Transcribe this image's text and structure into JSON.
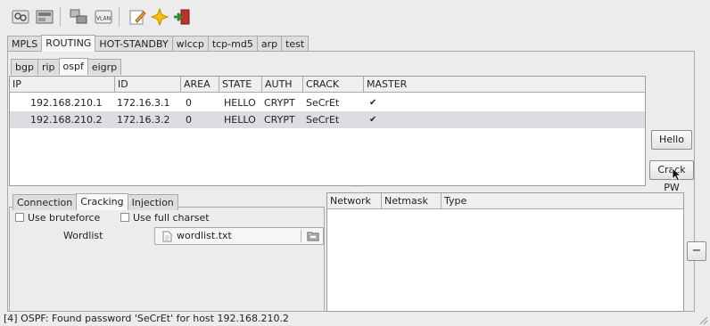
{
  "toolbar": {
    "buttons": [
      {
        "icon": "interfaces-icon"
      },
      {
        "icon": "card-icon"
      },
      {
        "icon": "network-icon"
      },
      {
        "icon": "vlan-icon",
        "text": "VLAN"
      },
      {
        "icon": "edit-icon"
      },
      {
        "icon": "star-icon"
      },
      {
        "icon": "exit-icon"
      }
    ]
  },
  "main_tabs": [
    "MPLS",
    "ROUTING",
    "HOT-STANDBY",
    "wlccp",
    "tcp-md5",
    "arp",
    "test"
  ],
  "sub_tabs": [
    "bgp",
    "rip",
    "ospf",
    "eigrp"
  ],
  "peer_table": {
    "columns": [
      "IP",
      "ID",
      "AREA",
      "STATE",
      "AUTH",
      "CRACK",
      "MASTER"
    ],
    "rows": [
      {
        "ip": "192.168.210.1",
        "id": "172.16.3.1",
        "area": "0",
        "state": "HELLO",
        "auth": "CRYPT",
        "crack": "SeCrEt",
        "master": "✔"
      },
      {
        "ip": "192.168.210.2",
        "id": "172.16.3.2",
        "area": "0",
        "state": "HELLO",
        "auth": "CRYPT",
        "crack": "SeCrEt",
        "master": "✔"
      }
    ]
  },
  "buttons": {
    "hello": "Hello",
    "crack_pw": "Crack PW",
    "remove": "−"
  },
  "lower_tabs": [
    "Connection",
    "Cracking",
    "Injection"
  ],
  "cracking": {
    "bruteforce_label": "Use bruteforce",
    "full_charset_label": "Use full charset",
    "wordlist_label": "Wordlist",
    "wordlist_value": "wordlist.txt"
  },
  "net_table": {
    "columns": [
      "Network",
      "Netmask",
      "Type"
    ]
  },
  "status": {
    "message": "[4] OSPF: Found password 'SeCrEt' for host 192.168.210.2"
  }
}
